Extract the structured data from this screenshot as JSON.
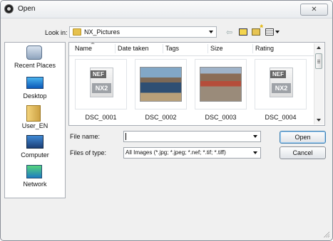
{
  "window": {
    "title": "Open",
    "close_label": "✕"
  },
  "look_in": {
    "label": "Look in:",
    "value": "NX_Pictures"
  },
  "places": [
    "Recent Places",
    "Desktop",
    "User_EN",
    "Computer",
    "Network"
  ],
  "columns": [
    "Name",
    "Date taken",
    "Tags",
    "Size",
    "Rating"
  ],
  "files": [
    "DSC_0001",
    "DSC_0002",
    "DSC_0003",
    "DSC_0004"
  ],
  "nef_badge": "NEF",
  "nx_badge": "NX2",
  "file_name": {
    "label": "File name:",
    "value": ""
  },
  "file_type": {
    "label": "Files of type:",
    "value": "All Images (*.jpg; *.jpeg; *.nef; *.tif; *.tiff)"
  },
  "buttons": {
    "open": "Open",
    "cancel": "Cancel"
  },
  "toolbar": {
    "back_icon": "back-arrow-icon",
    "up_icon": "up-folder-icon",
    "new_folder_icon": "new-folder-icon",
    "views_icon": "views-icon"
  }
}
